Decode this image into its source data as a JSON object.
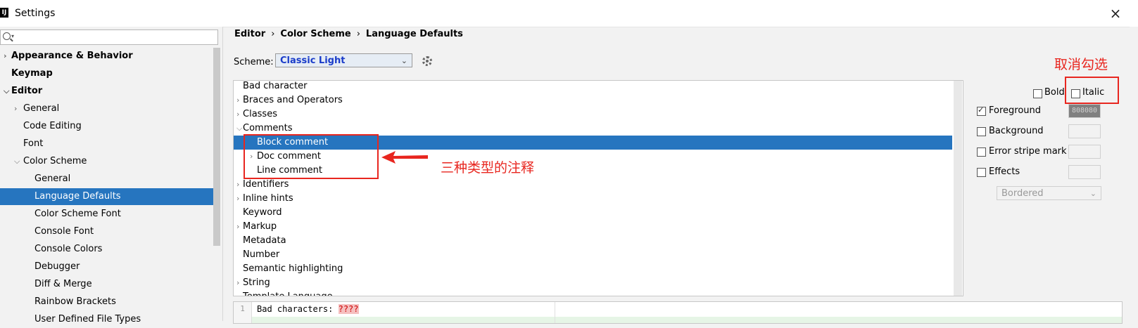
{
  "window": {
    "title": "Settings",
    "close_label": "×"
  },
  "left": {
    "search": {
      "placeholder": ""
    },
    "items": [
      {
        "label": "Appearance & Behavior",
        "arrow": "›",
        "bold": true,
        "indent": 0
      },
      {
        "label": "Keymap",
        "arrow": "",
        "bold": true,
        "indent": 0
      },
      {
        "label": "Editor",
        "arrow": "⌄",
        "bold": true,
        "indent": 0
      },
      {
        "label": "General",
        "arrow": "›",
        "indent": 1
      },
      {
        "label": "Code Editing",
        "arrow": "",
        "indent": 1
      },
      {
        "label": "Font",
        "arrow": "",
        "indent": 1
      },
      {
        "label": "Color Scheme",
        "arrow": "⌄",
        "indent": 1
      },
      {
        "label": "General",
        "arrow": "",
        "indent": 2
      },
      {
        "label": "Language Defaults",
        "arrow": "",
        "indent": 2,
        "selected": true
      },
      {
        "label": "Color Scheme Font",
        "arrow": "",
        "indent": 2
      },
      {
        "label": "Console Font",
        "arrow": "",
        "indent": 2
      },
      {
        "label": "Console Colors",
        "arrow": "",
        "indent": 2
      },
      {
        "label": "Debugger",
        "arrow": "",
        "indent": 2
      },
      {
        "label": "Diff & Merge",
        "arrow": "",
        "indent": 2
      },
      {
        "label": "Rainbow Brackets",
        "arrow": "",
        "indent": 2
      },
      {
        "label": "User Defined File Types",
        "arrow": "",
        "indent": 2
      }
    ]
  },
  "breadcrumb": {
    "part1": "Editor",
    "part2": "Color Scheme",
    "part3": "Language Defaults",
    "sep": "›"
  },
  "scheme": {
    "label": "Scheme:",
    "value": "Classic Light"
  },
  "list": {
    "rows": [
      {
        "label": "Bad character",
        "arrow": "",
        "indent": 0
      },
      {
        "label": "Braces and Operators",
        "arrow": "›",
        "indent": 0
      },
      {
        "label": "Classes",
        "arrow": "›",
        "indent": 0
      },
      {
        "label": "Comments",
        "arrow": "⌄",
        "indent": 0
      },
      {
        "label": "Block comment",
        "arrow": "",
        "indent": 1,
        "selected": true
      },
      {
        "label": "Doc comment",
        "arrow": "›",
        "indent": 1
      },
      {
        "label": "Line comment",
        "arrow": "",
        "indent": 1
      },
      {
        "label": "Identifiers",
        "arrow": "›",
        "indent": 0
      },
      {
        "label": "Inline hints",
        "arrow": "›",
        "indent": 0
      },
      {
        "label": "Keyword",
        "arrow": "",
        "indent": 0
      },
      {
        "label": "Markup",
        "arrow": "›",
        "indent": 0
      },
      {
        "label": "Metadata",
        "arrow": "",
        "indent": 0
      },
      {
        "label": "Number",
        "arrow": "",
        "indent": 0
      },
      {
        "label": "Semantic highlighting",
        "arrow": "",
        "indent": 0
      },
      {
        "label": "String",
        "arrow": "›",
        "indent": 0
      },
      {
        "label": "Template Language",
        "arrow": "",
        "indent": 0
      }
    ]
  },
  "attributes": {
    "bold": {
      "label": "Bold",
      "checked": false
    },
    "italic": {
      "label": "Italic",
      "checked": false
    },
    "foreground": {
      "label": "Foreground",
      "checked": true,
      "value": "808080"
    },
    "background": {
      "label": "Background",
      "checked": false
    },
    "error_stripe": {
      "label": "Error stripe mark",
      "checked": false
    },
    "effects": {
      "label": "Effects",
      "checked": false,
      "style": "Bordered"
    }
  },
  "preview": {
    "line_number": "1",
    "code": "Bad characters: ",
    "bad": "????"
  },
  "annotations": {
    "uncheck_text": "取消勾选",
    "comment_types_text": "三种类型的注释",
    "color": "#e8261f"
  },
  "colors": {
    "selection": "#2675bf",
    "scheme_text": "#1a3cc9"
  }
}
